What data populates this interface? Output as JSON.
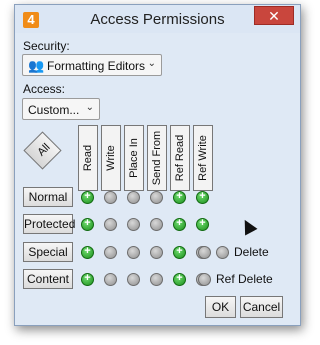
{
  "window": {
    "title": "Access Permissions",
    "app_badge": "4",
    "close_glyph": "✕"
  },
  "security": {
    "label": "Security:",
    "value": "Formatting Editors"
  },
  "access": {
    "label": "Access:",
    "value": "Custom..."
  },
  "all_button": "All",
  "columns": [
    "Read",
    "Write",
    "Place In",
    "Send From",
    "Ref Read",
    "Ref Write"
  ],
  "rows": [
    {
      "label": "Normal",
      "states": [
        true,
        false,
        false,
        false,
        true,
        true
      ],
      "extras": []
    },
    {
      "label": "Protected",
      "states": [
        true,
        false,
        false,
        false,
        true,
        true
      ],
      "extras": []
    },
    {
      "label": "Special",
      "states": [
        true,
        false,
        false,
        false,
        true,
        false
      ],
      "extras": [
        false,
        false
      ],
      "extra_label": "Delete"
    },
    {
      "label": "Content",
      "states": [
        true,
        false,
        false,
        false,
        true,
        false
      ],
      "extras": [
        false
      ],
      "extra_label": "Ref Delete"
    }
  ],
  "buttons": {
    "ok": "OK",
    "cancel": "Cancel"
  }
}
